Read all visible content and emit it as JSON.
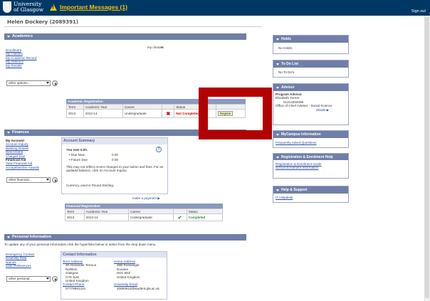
{
  "header": {
    "logo_line1": "University",
    "logo_line2": "of Glasgow",
    "important_messages": "Important Messages (1)",
    "sign_out": "Sign out"
  },
  "user": {
    "name": "Helen Dockery (2089391)"
  },
  "academics": {
    "title": "Academics",
    "links": [
      "Enrollment",
      "My Classes",
      "My Academic Record",
      "My Absence",
      "My Results"
    ],
    "my_choices": "my choices",
    "other_options": "other options...",
    "registration": {
      "caption": "Academic Registration",
      "headers": [
        "Term",
        "Academic Year",
        "Career",
        "",
        "Status",
        ""
      ],
      "row": {
        "term": "2013",
        "academic_year": "2013-14",
        "career": "Undergraduate",
        "status": "Not Completed",
        "action": "Registe"
      }
    }
  },
  "finances": {
    "title": "Finances",
    "my_account": "My Account",
    "account_links": [
      "Account Inquiry",
      "Banking Details",
      "Direct Debit",
      "Charges Due"
    ],
    "financial_aid": "Financial Aid",
    "aid_links": [
      "View Financial Aid",
      "Accept/Decline Awards"
    ],
    "other_financial": "other financial...",
    "summary": {
      "title": "Account Summary",
      "owe": "You owe 0.00.",
      "due_now_label": "Due Now",
      "due_now_value": "0.00",
      "future_due_label": "Future Due",
      "future_due_value": "0.00",
      "note": "This may not reflect recent changes to your tuition and fees. For an updated balance, click on Account Inquiry.",
      "currency": "Currency used is Pound Sterling.",
      "make_payment": "make a payment"
    },
    "registration": {
      "caption": "Financial Registration",
      "headers": [
        "Term",
        "Academic Year",
        "Career",
        "",
        "Status"
      ],
      "row": {
        "term": "2013",
        "academic_year": "2013-14",
        "career": "Undergraduate",
        "status": "Completed"
      }
    }
  },
  "personal": {
    "title": "Personal Information",
    "intro": "To update any of your personal information click the hyperlinks below or select from the drop down menu.",
    "links": [
      "Emergency Contact",
      "Disability Data",
      "Names",
      "User Preferences"
    ],
    "other_personal": "other personal...",
    "contact": {
      "title": "Contact Information",
      "term_address_label": "Term Address",
      "term_address": [
        "20 Alexander Terrace",
        "Neilston",
        "Glasgow",
        "G78 3LW",
        "United Kingdom"
      ],
      "home_address_label": "Home Address",
      "home_address": [
        "26B Roseangle",
        "Dundee",
        "DD1 5DZ",
        "United Kingdom"
      ],
      "contact_phone_label": "Contact Phone",
      "contact_phone": "07779991234",
      "email_label": "University Email",
      "email": "2089391d@student.gla.ac.uk"
    }
  },
  "sidebar": {
    "holds": {
      "title": "Holds",
      "text": "No Holds."
    },
    "todo": {
      "title": "To Do List",
      "text": "No To Do's."
    },
    "advisor": {
      "title": "Advisor",
      "program_advisor": "Program Advisor",
      "name": "Elizabeth Turner",
      "phone": "01413304098",
      "office": "Office of Chief Adviser - Social Science",
      "details": "details"
    },
    "mycampus": {
      "title": "MyCampus Information",
      "link": "Frequently Asked Questions"
    },
    "registration": {
      "title": "Registration & Enrolment Help",
      "links": [
        "Registration & Enrolment Guide",
        "School Enrolment Information"
      ]
    },
    "help": {
      "title": "Help & Support",
      "link": "IT Helpdesk"
    }
  },
  "colors": {
    "topbar": "#003865",
    "section_bar": "#6f7fa8",
    "alert_yellow": "#f2c200",
    "error_red": "#cc0000",
    "overlay_red": "#b30000",
    "success_green": "#2e8b2e"
  }
}
